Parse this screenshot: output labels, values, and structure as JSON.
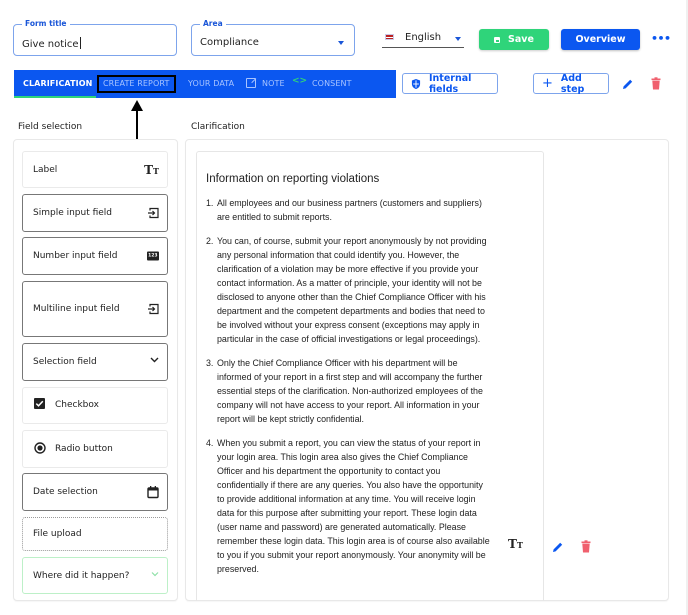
{
  "header": {
    "form_title": {
      "legend": "Form title",
      "value": "Give notice"
    },
    "area": {
      "legend": "Area",
      "value": "Compliance"
    },
    "language": {
      "value": "English",
      "flag_icon": "uk-flag-icon"
    },
    "save_label": "Save",
    "overview_label": "Overview",
    "more_label": "•••"
  },
  "tabs": [
    {
      "label": "CLARIFICATION",
      "active": true
    },
    {
      "label": "CREATE REPORT",
      "active": false,
      "highlighted": true
    },
    {
      "label": "YOUR DATA",
      "active": false
    },
    {
      "label": "NOTE",
      "active": false,
      "icon": "external-edit-icon"
    },
    {
      "label": "CONSENT",
      "active": false,
      "icon": "code-icon"
    }
  ],
  "toolbar": {
    "internal_fields_label": "Internal fields",
    "add_step_label": "Add step"
  },
  "field_selection": {
    "title": "Field selection",
    "items": [
      {
        "label": "Label",
        "icon": "text-size-icon"
      },
      {
        "label": "Simple input field",
        "icon": "input-icon"
      },
      {
        "label": "Number input field",
        "icon": "number-123-icon"
      },
      {
        "label": "Multiline input field",
        "icon": "input-icon"
      },
      {
        "label": "Selection field",
        "icon": "chevron-down-icon"
      },
      {
        "label": "Checkbox",
        "icon": "checkbox-checked-icon"
      },
      {
        "label": "Radio button",
        "icon": "radio-selected-icon"
      },
      {
        "label": "Date selection",
        "icon": "calendar-icon"
      },
      {
        "label": "File upload",
        "icon": ""
      },
      {
        "label": "Where did it happen?",
        "icon": "chevron-down-icon"
      }
    ]
  },
  "clarification": {
    "title": "Clarification",
    "heading": "Information on reporting violations",
    "items": [
      {
        "num": "1.",
        "text": "All employees and our business partners (customers and suppliers) are entitled to submit reports."
      },
      {
        "num": "2.",
        "text": "You can, of course, submit your report anonymously by not providing any personal information that could identify you. However, the clarification of a violation may be more effective if you provide your contact information. As a matter of principle, your identity will not be disclosed to anyone other than the Chief Compliance Officer with his department and the competent departments and bodies that need to be involved without your express consent (exceptions may apply in particular in the case of official investigations or legal proceedings)."
      },
      {
        "num": "3.",
        "text": "Only the Chief Compliance Officer with his department will be informed of your report in a first step and will accompany the further essential steps of the clarification. Non-authorized employees of the company will not have access to your report. All information in your report will be kept strictly confidential."
      },
      {
        "num": "4.",
        "text": "When you submit a report, you can view the status of your report in your login area. This login area also gives the Chief Compliance Officer and his department the opportunity to contact you confidentially if there are any queries. You also have the opportunity to provide additional information at any time. You will receive login data for this purpose after submitting your report. These login data (user name and password) are generated automatically. Please remember these login data. This login area is of course also available to you if you submit your report anonymously. Your anonymity will be preserved."
      }
    ],
    "element_type_icon": "text-size-icon"
  },
  "colors": {
    "primary": "#0b57f0",
    "success": "#2fd47a",
    "danger": "#f0606e",
    "tab_inactive": "#a8c4ff"
  }
}
